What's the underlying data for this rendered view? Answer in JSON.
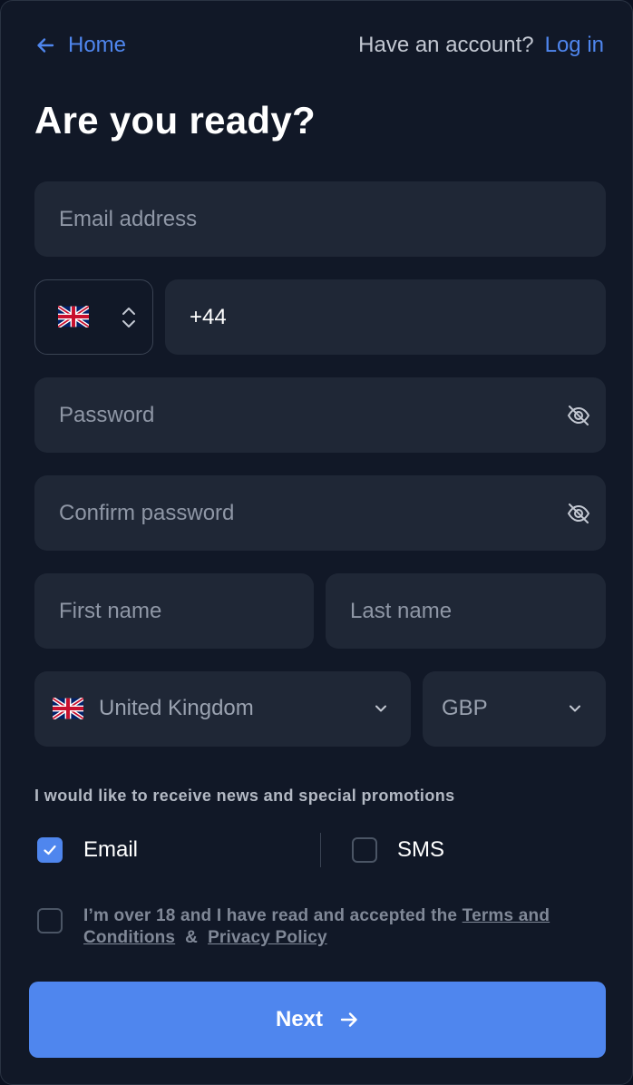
{
  "nav": {
    "home_label": "Home",
    "have_account_text": "Have an account?",
    "login_label": "Log in"
  },
  "title": "Are you ready?",
  "form": {
    "email": {
      "placeholder": "Email address",
      "value": ""
    },
    "phone": {
      "country_flag": "uk-flag-icon",
      "code": "+44"
    },
    "password": {
      "placeholder": "Password"
    },
    "confirm_password": {
      "placeholder": "Confirm password"
    },
    "first_name": {
      "placeholder": "First name"
    },
    "last_name": {
      "placeholder": "Last name"
    },
    "country": {
      "selected": "United Kingdom",
      "flag": "uk-flag-icon"
    },
    "currency": {
      "selected": "GBP"
    }
  },
  "promotions": {
    "heading": "I would like to receive news and special promotions",
    "email": {
      "label": "Email",
      "checked": true
    },
    "sms": {
      "label": "SMS",
      "checked": false
    }
  },
  "terms": {
    "checked": false,
    "prefix": "I’m over 18 and I have read and accepted the",
    "terms_link": "Terms and Conditions",
    "amp": "&",
    "privacy_link": "Privacy Policy"
  },
  "next_button": {
    "label": "Next",
    "icon": "arrow-right-icon"
  },
  "colors": {
    "accent": "#4f86ee",
    "background": "#111827",
    "field": "#1f2736"
  }
}
